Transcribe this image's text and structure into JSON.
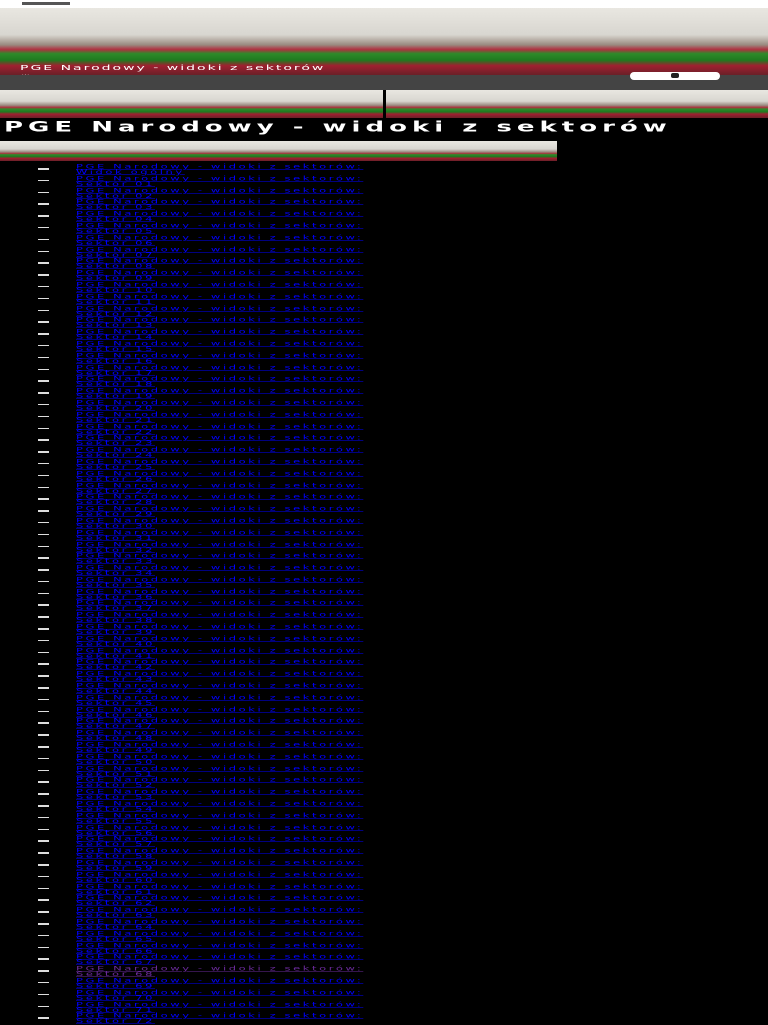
{
  "header": {
    "title": "PGE Narodowy - widoki z sektorów",
    "subtitle": "Warszawa"
  },
  "page_title": "PGE Narodowy - widoki z sektorów",
  "link_prefix": "PGE Narodowy - widoki z sektorów:",
  "visited_index": 68,
  "links": [
    "Widok ogólny",
    "Sektor 01",
    "Sektor 02",
    "Sektor 03",
    "Sektor 04",
    "Sektor 05",
    "Sektor 06",
    "Sektor 07",
    "Sektor 08",
    "Sektor 09",
    "Sektor 10",
    "Sektor 11",
    "Sektor 12",
    "Sektor 13",
    "Sektor 14",
    "Sektor 15",
    "Sektor 16",
    "Sektor 17",
    "Sektor 18",
    "Sektor 19",
    "Sektor 20",
    "Sektor 21",
    "Sektor 22",
    "Sektor 23",
    "Sektor 24",
    "Sektor 25",
    "Sektor 26",
    "Sektor 27",
    "Sektor 28",
    "Sektor 29",
    "Sektor 30",
    "Sektor 31",
    "Sektor 32",
    "Sektor 33",
    "Sektor 34",
    "Sektor 35",
    "Sektor 36",
    "Sektor 37",
    "Sektor 38",
    "Sektor 39",
    "Sektor 40",
    "Sektor 41",
    "Sektor 42",
    "Sektor 43",
    "Sektor 44",
    "Sektor 45",
    "Sektor 46",
    "Sektor 47",
    "Sektor 48",
    "Sektor 49",
    "Sektor 50",
    "Sektor 51",
    "Sektor 52",
    "Sektor 53",
    "Sektor 54",
    "Sektor 55",
    "Sektor 56",
    "Sektor 57",
    "Sektor 58",
    "Sektor 59",
    "Sektor 60",
    "Sektor 61",
    "Sektor 62",
    "Sektor 63",
    "Sektor 64",
    "Sektor 65",
    "Sektor 66",
    "Sektor 67",
    "Sektor 68",
    "Sektor 69",
    "Sektor 70",
    "Sektor 71",
    "Sektor 72"
  ]
}
